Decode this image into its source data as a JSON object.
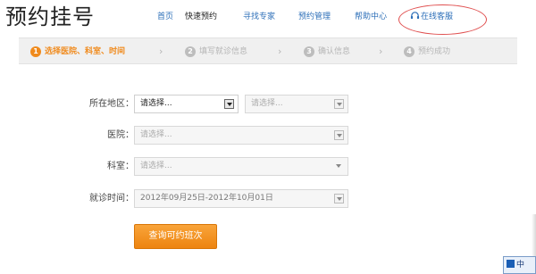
{
  "header": {
    "title": "预约挂号",
    "nav": [
      {
        "label": "首页"
      },
      {
        "label": "快速预约"
      },
      {
        "label": "寻找专家"
      },
      {
        "label": "预约管理"
      },
      {
        "label": "帮助中心"
      },
      {
        "label": "在线客服"
      }
    ],
    "active_nav": "快速预约"
  },
  "steps": [
    {
      "number": "1",
      "label": "选择医院、科室、时间",
      "active": true
    },
    {
      "number": "2",
      "label": "填写就诊信息",
      "active": false
    },
    {
      "number": "3",
      "label": "确认信息",
      "active": false
    },
    {
      "number": "4",
      "label": "预约成功",
      "active": false
    }
  ],
  "step_separator": "›",
  "form": {
    "region": {
      "label": "所在地区：",
      "province_value": "请选择...",
      "city_placeholder": "请选择..."
    },
    "hospital": {
      "label": "医院：",
      "placeholder": "请选择..."
    },
    "department": {
      "label": "科室：",
      "placeholder": "请选择..."
    },
    "visit_time": {
      "label": "就诊时间：",
      "value": "2012年09月25日-2012年10月01日"
    }
  },
  "query_button": {
    "label": "查询可约班次"
  },
  "ime": {
    "label": "中"
  },
  "colors": {
    "accent": "#f08a1c",
    "nav_link": "#2d6fb8",
    "highlight_circle": "#e05050"
  }
}
